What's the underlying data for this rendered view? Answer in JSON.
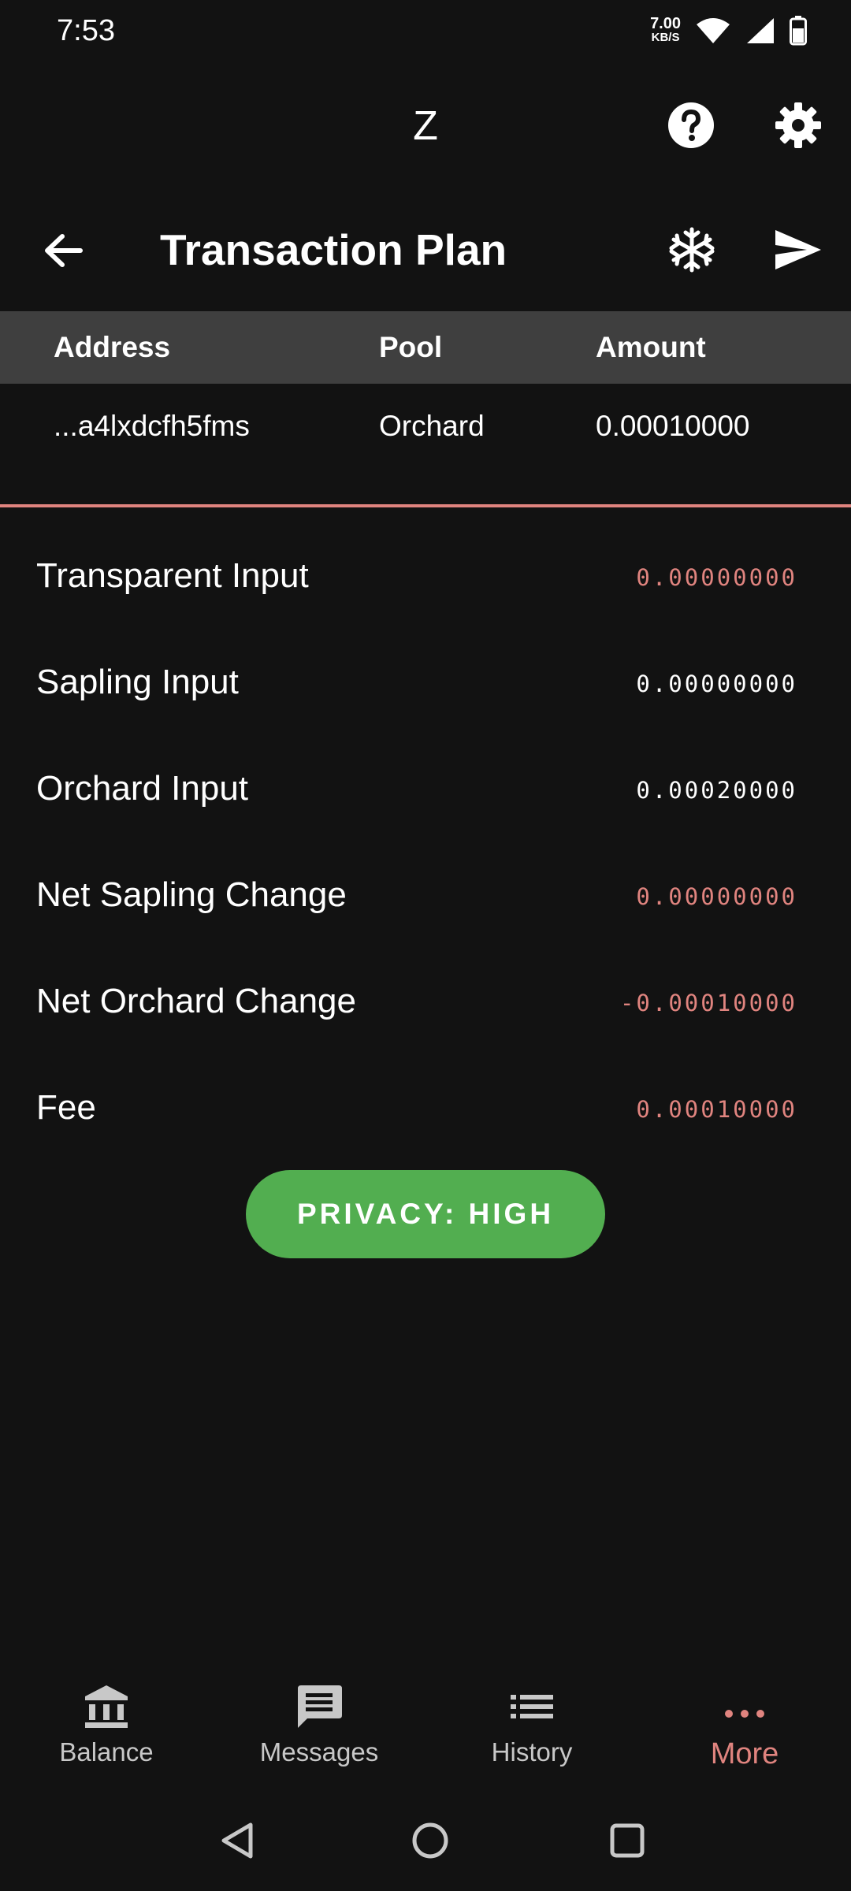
{
  "status_bar": {
    "time": "7:53",
    "net_speed_value": "7.00",
    "net_speed_unit": "KB/S"
  },
  "app_bar": {
    "title": "Z"
  },
  "page": {
    "title": "Transaction Plan"
  },
  "table": {
    "headers": {
      "address": "Address",
      "pool": "Pool",
      "amount": "Amount"
    },
    "rows": [
      {
        "address": "...a4lxdcfh5fms",
        "pool": "Orchard",
        "amount": "0.00010000"
      }
    ]
  },
  "summary": [
    {
      "label": "Transparent Input",
      "value": "0.00000000",
      "color": "#e0847f"
    },
    {
      "label": "Sapling Input",
      "value": "0.00000000",
      "color": "#ffffff"
    },
    {
      "label": "Orchard Input",
      "value": "0.00020000",
      "color": "#ffffff"
    },
    {
      "label": "Net Sapling Change",
      "value": "0.00000000",
      "color": "#e0847f"
    },
    {
      "label": "Net Orchard Change",
      "value": "-0.00010000",
      "color": "#e0847f"
    },
    {
      "label": "Fee",
      "value": "0.00010000",
      "color": "#e0847f"
    }
  ],
  "privacy": {
    "label": "PRIVACY: HIGH",
    "color": "#52ae50"
  },
  "bottom_nav": [
    {
      "label": "Balance",
      "icon": "bank-icon"
    },
    {
      "label": "Messages",
      "icon": "message-icon"
    },
    {
      "label": "History",
      "icon": "list-icon"
    },
    {
      "label": "More",
      "icon": "more-horizontal-icon",
      "active": true
    }
  ],
  "colors": {
    "accent": "#e0847f",
    "background": "#121212",
    "header_bg": "#3f3f3f"
  }
}
